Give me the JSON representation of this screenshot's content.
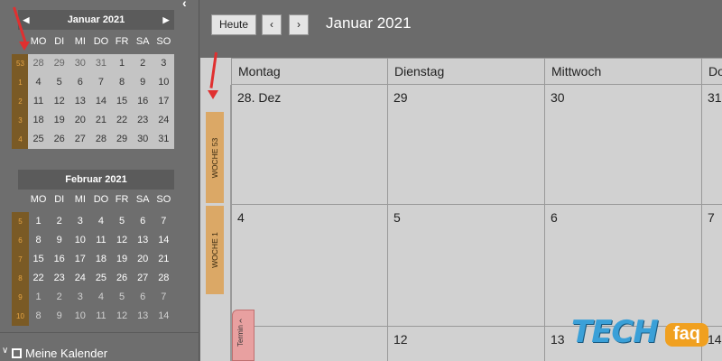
{
  "sidebar": {
    "jan": {
      "title": "Januar 2021",
      "weeks": [
        "53",
        "1",
        "2",
        "3",
        "4"
      ],
      "rows": [
        [
          "28",
          "29",
          "30",
          "31",
          "1",
          "2",
          "3"
        ],
        [
          "4",
          "5",
          "6",
          "7",
          "8",
          "9",
          "10"
        ],
        [
          "11",
          "12",
          "13",
          "14",
          "15",
          "16",
          "17"
        ],
        [
          "18",
          "19",
          "20",
          "21",
          "22",
          "23",
          "24"
        ],
        [
          "25",
          "26",
          "27",
          "28",
          "29",
          "30",
          "31"
        ]
      ]
    },
    "feb": {
      "title": "Februar 2021",
      "weeks": [
        "5",
        "6",
        "7",
        "8",
        "9",
        "10"
      ],
      "rows": [
        [
          "1",
          "2",
          "3",
          "4",
          "5",
          "6",
          "7"
        ],
        [
          "8",
          "9",
          "10",
          "11",
          "12",
          "13",
          "14"
        ],
        [
          "15",
          "16",
          "17",
          "18",
          "19",
          "20",
          "21"
        ],
        [
          "22",
          "23",
          "24",
          "25",
          "26",
          "27",
          "28"
        ],
        [
          "1",
          "2",
          "3",
          "4",
          "5",
          "6",
          "7"
        ],
        [
          "8",
          "9",
          "10",
          "11",
          "12",
          "13",
          "14"
        ]
      ]
    },
    "dow": [
      "MO",
      "DI",
      "MI",
      "DO",
      "FR",
      "SA",
      "SO"
    ],
    "meine_kalender": "Meine Kalender"
  },
  "toolbar": {
    "today": "Heute",
    "title": "Januar 2021"
  },
  "calendar": {
    "headers": [
      "Montag",
      "Dienstag",
      "Mittwoch",
      "Do"
    ],
    "week_tabs": [
      "WOCHE 53",
      "WOCHE 1"
    ],
    "rows": [
      [
        "28. Dez",
        "29",
        "30",
        "31"
      ],
      [
        "4",
        "5",
        "6",
        "7"
      ],
      [
        "",
        "12",
        "13",
        "14"
      ]
    ],
    "termin_label": "Termin"
  },
  "logo": {
    "tech": "TECH",
    "faq": "faq"
  },
  "colors": {
    "accent_arrow": "#e03030",
    "week_strip": "#7a5a25",
    "week_tab": "#dba866"
  }
}
